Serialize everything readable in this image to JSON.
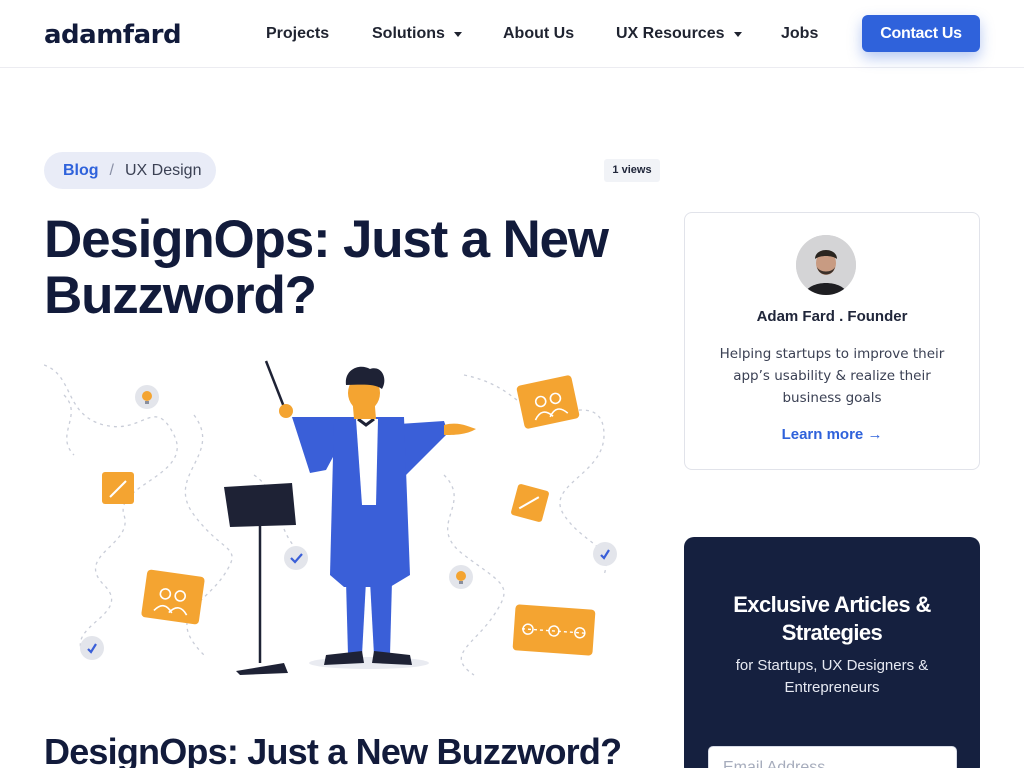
{
  "brand": {
    "logo_text": "adamfard",
    "accent": "#2f62db",
    "navy": "#121b3b"
  },
  "nav": {
    "items": [
      {
        "label": "Projects",
        "has_dropdown": false
      },
      {
        "label": "Solutions",
        "has_dropdown": true
      },
      {
        "label": "About Us",
        "has_dropdown": false
      },
      {
        "label": "UX Resources",
        "has_dropdown": true
      },
      {
        "label": "Jobs",
        "has_dropdown": false
      }
    ],
    "cta_label": "Contact Us"
  },
  "breadcrumb": {
    "root": "Blog",
    "separator": "/",
    "current": "UX Design"
  },
  "views": "1 views",
  "article": {
    "title": "DesignOps: Just a New Buzzword?",
    "subtitle": "DesignOps: Just a New Buzzword?"
  },
  "author_card": {
    "name": "Adam Fard . Founder",
    "bio": "Helping startups to improve their app’s usability & realize their business goals",
    "link_label": "Learn more",
    "link_icon": "arrow-right-icon"
  },
  "newsletter": {
    "title": "Exclusive Articles & Strategies",
    "subtitle": "for Startups, UX Designers & Entrepreneurs",
    "email_placeholder": "Email Address"
  },
  "illustration": {
    "subject": "conductor-illustration",
    "accent_color": "#f4a431",
    "suit_color": "#3a5fd8"
  }
}
